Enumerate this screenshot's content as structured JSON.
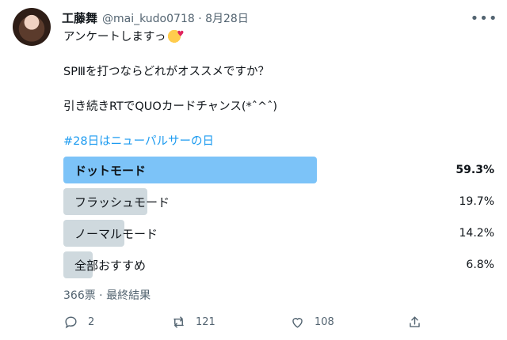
{
  "tweet": {
    "display_name": "工藤舞",
    "handle_and_date": "@mai_kudo0718 · 8月28日",
    "more_icon": "more-horizontal-icon",
    "lines": {
      "line1": "アンケートしますっ",
      "line2": "SPⅢを打つならどれがオススメですか？",
      "line3": "引き続きRTでQUOカードチャンス(*ˆ^ˆ)",
      "hashtag": "#28日はニューパルサーの日"
    }
  },
  "poll": {
    "choices": [
      {
        "label": "ドットモード",
        "percent": "59.3%",
        "fraction": 0.593,
        "winner": true
      },
      {
        "label": "フラッシュモード",
        "percent": "19.7%",
        "fraction": 0.197,
        "winner": false
      },
      {
        "label": "ノーマルモード",
        "percent": "14.2%",
        "fraction": 0.142,
        "winner": false
      },
      {
        "label": "全部おすすめ",
        "percent": "6.8%",
        "fraction": 0.068,
        "winner": false
      }
    ],
    "meta": "366票 · 最終結果"
  },
  "actions": {
    "reply_count": "2",
    "retweet_count": "121",
    "like_count": "108"
  },
  "colors": {
    "accent": "#1d9bf0",
    "winner_bar": "#7cc3f8",
    "bar": "#cfd9de",
    "muted": "#536471"
  }
}
